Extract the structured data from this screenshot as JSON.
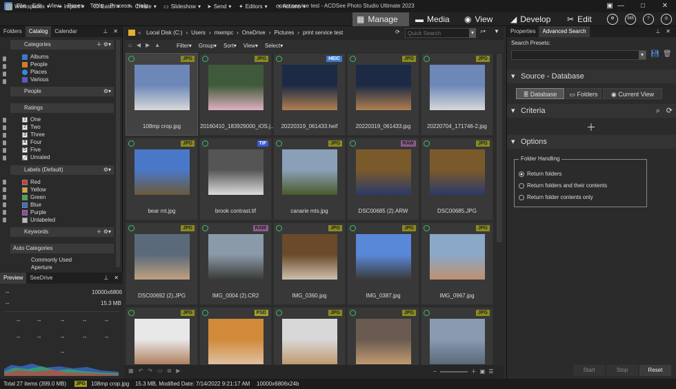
{
  "titlebar": {
    "menus": [
      "File",
      "Edit",
      "View",
      "Panes",
      "Tools",
      "Process",
      "Help"
    ],
    "title": "print service test - ACDSee Photo Studio Ultimate 2023"
  },
  "toolbar": {
    "items": [
      {
        "label": "Workspaces",
        "icon": "grid-icon"
      },
      {
        "label": "Import",
        "icon": "import-icon"
      },
      {
        "label": "Batch",
        "icon": "batch-icon"
      },
      {
        "label": "Create",
        "icon": "create-icon"
      },
      {
        "label": "Slideshow",
        "icon": "slideshow-icon"
      },
      {
        "label": "Send",
        "icon": "send-icon"
      },
      {
        "label": "Editors",
        "icon": "editors-icon"
      },
      {
        "label": "Actions",
        "icon": "actions-icon"
      }
    ],
    "modes": [
      {
        "label": "Manage",
        "icon": "manage-icon",
        "active": true
      },
      {
        "label": "Media",
        "icon": "media-icon",
        "active": false
      },
      {
        "label": "View",
        "icon": "eye-icon",
        "active": false
      },
      {
        "label": "Develop",
        "icon": "develop-icon",
        "active": false
      },
      {
        "label": "Edit",
        "icon": "edit-icon",
        "active": false
      }
    ],
    "badge_365": "365"
  },
  "left_panel": {
    "tabs": [
      "Folders",
      "Catalog",
      "Calendar"
    ],
    "active_tab": "Catalog",
    "categories_title": "Categories",
    "categories": [
      {
        "label": "Albums",
        "color": "#3a78c9"
      },
      {
        "label": "People",
        "color": "#d57a2b"
      },
      {
        "label": "Places",
        "color": "#2e8fd6"
      },
      {
        "label": "Various",
        "color": "#5a5ac8"
      }
    ],
    "people_title": "People",
    "ratings_title": "Ratings",
    "ratings": [
      {
        "num": "1",
        "label": "One"
      },
      {
        "num": "2",
        "label": "Two"
      },
      {
        "num": "3",
        "label": "Three"
      },
      {
        "num": "4",
        "label": "Four"
      },
      {
        "num": "5",
        "label": "Five"
      },
      {
        "num": "",
        "label": "Unrated"
      }
    ],
    "labels_title": "Labels (Default)",
    "labels": [
      {
        "label": "Red",
        "color": "#d23a3a"
      },
      {
        "label": "Yellow",
        "color": "#d8a930"
      },
      {
        "label": "Green",
        "color": "#3bab48"
      },
      {
        "label": "Blue",
        "color": "#2f6fd0"
      },
      {
        "label": "Purple",
        "color": "#9a3fb5"
      },
      {
        "label": "Unlabeled",
        "color": "#bbbbbb"
      }
    ],
    "keywords_title": "Keywords",
    "auto_categories_title": "Auto Categories",
    "auto_items": [
      "Commonly Used",
      "Aperture"
    ]
  },
  "preview": {
    "tabs": [
      "Preview",
      "SeeDrive"
    ],
    "dim": "10000x6806",
    "size": "15.3 MB",
    "dash": "--"
  },
  "address": {
    "path": [
      "Local Disk (C:)",
      "Users",
      "mwmpc",
      "OneDrive",
      "Pictures",
      "print service test"
    ],
    "search_placeholder": "Quick Search"
  },
  "viewbar": [
    "Filter",
    "Group",
    "Sort",
    "View",
    "Select"
  ],
  "thumbs": [
    {
      "name": "108mp crop.jpg",
      "badge": "JPG",
      "c1": "#6d88b8",
      "c2": "#d8d8d8",
      "sel": true
    },
    {
      "name": "20160410_183929000_iOS.j...",
      "badge": "JPG",
      "c1": "#3f5a3a",
      "c2": "#e0b0c0",
      "sel": false
    },
    {
      "name": "20220319_061433.heif",
      "badge": "HEIC",
      "c1": "#1c2a45",
      "c2": "#b08050",
      "sel": false
    },
    {
      "name": "20220319_061433.jpg",
      "badge": "JPG",
      "c1": "#1c2a45",
      "c2": "#b08050",
      "sel": false
    },
    {
      "name": "20220704_171746-2.jpg",
      "badge": "JPG",
      "c1": "#6d88b8",
      "c2": "#d8d8d8",
      "sel": false
    },
    {
      "name": "bear mt.jpg",
      "badge": "JPG",
      "c1": "#4a78c8",
      "c2": "#6a5a3a",
      "sel": false
    },
    {
      "name": "brook contrast.tif",
      "badge": "TIF",
      "c1": "#555555",
      "c2": "#dddddd",
      "sel": false
    },
    {
      "name": "canarie mts.jpg",
      "badge": "JPG",
      "c1": "#8aa0b8",
      "c2": "#4a5a2a",
      "sel": false
    },
    {
      "name": "DSC00685 (2).ARW",
      "badge": "RAW",
      "c1": "#7a5a2a",
      "c2": "#2a3a6a",
      "sel": false
    },
    {
      "name": "DSC00685.JPG",
      "badge": "JPG",
      "c1": "#7a5a2a",
      "c2": "#2a3a6a",
      "sel": false
    },
    {
      "name": "DSC00692 (2).JPG",
      "badge": "JPG",
      "c1": "#5a6a7a",
      "c2": "#c0a080",
      "sel": false
    },
    {
      "name": "IMG_0004 (2).CR2",
      "badge": "RAW",
      "c1": "#8a9aa8",
      "c2": "#3a3a38",
      "sel": false
    },
    {
      "name": "IMG_0360.jpg",
      "badge": "JPG",
      "c1": "#6a4a2a",
      "c2": "#d0c0b0",
      "sel": false
    },
    {
      "name": "IMG_0387.jpg",
      "badge": "JPG",
      "c1": "#5a88d8",
      "c2": "#3a3a3a",
      "sel": false
    },
    {
      "name": "IMG_0967.jpg",
      "badge": "JPG",
      "c1": "#8aa8c8",
      "c2": "#c09070",
      "sel": false
    },
    {
      "name": "",
      "badge": "JPG",
      "c1": "#e8e8e8",
      "c2": "#b08060",
      "sel": false
    },
    {
      "name": "",
      "badge": "PSD",
      "c1": "#d08a3a",
      "c2": "#e0c0a0",
      "sel": false
    },
    {
      "name": "",
      "badge": "JPG",
      "c1": "#d8d8d8",
      "c2": "#c09a70",
      "sel": false
    },
    {
      "name": "",
      "badge": "JPG",
      "c1": "#6a5a50",
      "c2": "#c09a70",
      "sel": false
    },
    {
      "name": "",
      "badge": "JPG",
      "c1": "#8a9ab0",
      "c2": "#5a6a7a",
      "sel": false
    }
  ],
  "right_panel": {
    "tabs": [
      "Properties",
      "Advanced Search"
    ],
    "active_tab": "Advanced Search",
    "search_presets_label": "Search Presets:",
    "source_title": "Source - Database",
    "source_buttons": [
      "Database",
      "Folders",
      "Current View"
    ],
    "criteria_title": "Criteria",
    "options_title": "Options",
    "folder_handling_title": "Folder Handling",
    "radio_options": [
      {
        "label": "Return folders",
        "checked": true
      },
      {
        "label": "Return folders and their contents",
        "checked": false
      },
      {
        "label": "Return folder contents only",
        "checked": false
      }
    ],
    "footer_buttons": [
      "Start",
      "Stop",
      "Reset"
    ]
  },
  "status": {
    "total": "Total 27 items  (399.0 MB)",
    "badge": "JPG",
    "file": "108mp crop.jpg",
    "info": "15.3 MB, Modified Date: 7/14/2022 9:21:17 AM",
    "dim": "10000x6806x24b"
  }
}
